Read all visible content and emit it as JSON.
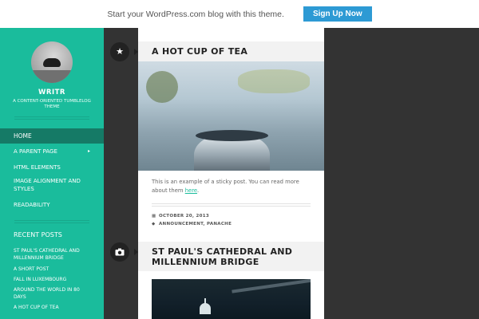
{
  "promo": {
    "text": "Start your WordPress.com blog with this theme.",
    "button": "Sign Up Now"
  },
  "sidebar": {
    "site_title": "WRITR",
    "site_description": "A CONTENT-ORIENTED TUMBLELOG THEME",
    "nav": [
      {
        "label": "HOME"
      },
      {
        "label": "A PARENT PAGE"
      },
      {
        "label": "HTML ELEMENTS"
      },
      {
        "label": "IMAGE ALIGNMENT AND STYLES"
      },
      {
        "label": "READABILITY"
      }
    ],
    "recent_title": "RECENT POSTS",
    "recent": [
      {
        "label": "ST PAUL'S CATHEDRAL AND MILLENNIUM BRIDGE"
      },
      {
        "label": "A SHORT POST"
      },
      {
        "label": "FALL IN LUXEMBOURG"
      },
      {
        "label": "AROUND THE WORLD IN 80 DAYS"
      },
      {
        "label": "A HOT CUP OF TEA"
      }
    ]
  },
  "posts": [
    {
      "icon": "star-icon",
      "title": "A HOT CUP OF TEA",
      "excerpt_before": "This is an example of a sticky post. You can read more about them ",
      "excerpt_link": "here",
      "excerpt_after": ".",
      "date": "OCTOBER 20, 2013",
      "tags": "ANNOUNCEMENT, PANACHE"
    },
    {
      "icon": "camera-icon",
      "title": "ST PAUL'S CATHEDRAL AND MILLENNIUM BRIDGE"
    }
  ],
  "colors": {
    "accent": "#1abc9c",
    "sidebar_active": "#157a66",
    "background": "#333333",
    "promo_button": "#2d9ad4"
  }
}
